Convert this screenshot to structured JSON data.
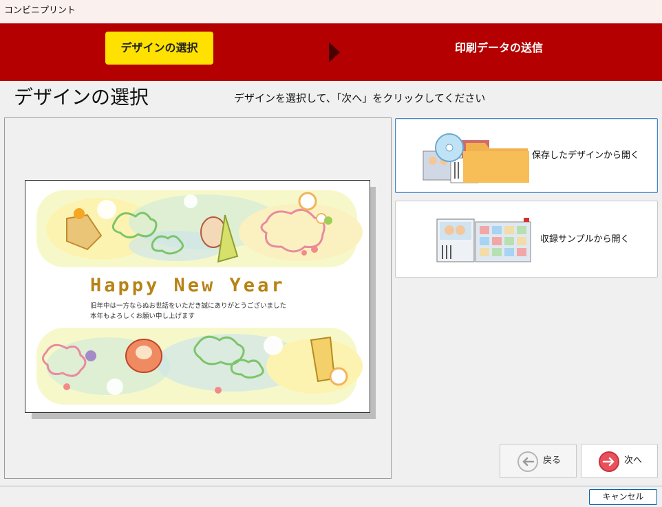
{
  "window": {
    "title": "コンビニプリント"
  },
  "steps": [
    {
      "label": "デザインの選択",
      "active": true
    },
    {
      "label": "印刷データの送信",
      "active": false
    }
  ],
  "page": {
    "title": "デザインの選択",
    "instruction": "デザインを選択して、「次へ」をクリックしてください"
  },
  "preview": {
    "heading": "Happy New Year",
    "message_line1": "旧年中は一方ならぬお世話をいただき誠にありがとうございました",
    "message_line2": "本年もよろしくお願い申し上げます"
  },
  "options": [
    {
      "label": "保存したデザインから開く",
      "icon": "saved-design-folder-icon",
      "selected": true
    },
    {
      "label": "収録サンプルから開く",
      "icon": "sample-catalog-icon",
      "selected": false
    }
  ],
  "navigation": {
    "back_label": "戻る",
    "next_label": "次へ",
    "cancel_label": "キャンセル"
  },
  "colors": {
    "banner": "#b40000",
    "active_step": "#ffe100",
    "next_icon": "#e8505b"
  }
}
